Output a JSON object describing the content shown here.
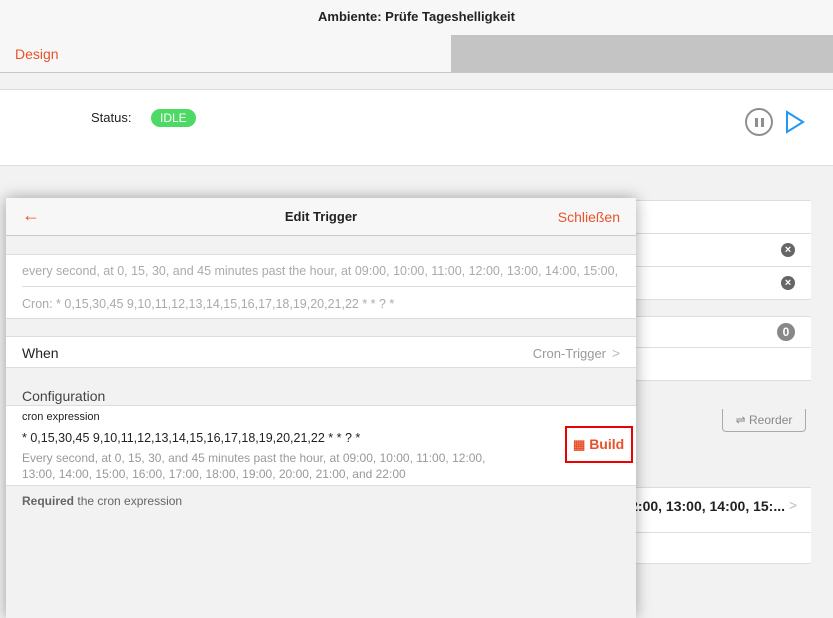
{
  "header": {
    "title": "Ambiente: Prüfe Tageshelligkeit"
  },
  "tabs": [
    {
      "label": "Design"
    }
  ],
  "status": {
    "label": "Status:",
    "value": "IDLE"
  },
  "background": {
    "badge_count": "0",
    "reorder_label": "Reorder",
    "cron_preview": "2:00, 13:00, 14:00, 15:..."
  },
  "modal": {
    "title": "Edit Trigger",
    "close_label": "Schließen",
    "description": "every second, at 0, 15, 30, and 45 minutes past the hour, at 09:00, 10:00, 11:00, 12:00, 13:00, 14:00, 15:00,",
    "cron_line": "Cron: * 0,15,30,45 9,10,11,12,13,14,15,16,17,18,19,20,21,22 * * ? *",
    "when_label": "When",
    "when_value": "Cron-Trigger",
    "config_header": "Configuration",
    "field_label": "cron expression",
    "field_value": "* 0,15,30,45 9,10,11,12,13,14,15,16,17,18,19,20,21,22 * * ? *",
    "field_desc": "Every second, at 0, 15, 30, and 45 minutes past the hour, at 09:00, 10:00, 11:00, 12:00, 13:00, 14:00, 15:00, 16:00, 17:00, 18:00, 19:00, 20:00, 21:00, and 22:00",
    "build_label": "Build",
    "required_bold": "Required",
    "required_text": "the cron expression"
  },
  "colors": {
    "accent": "#e8532a",
    "idle": "#4cd964",
    "play": "#2196f3"
  }
}
